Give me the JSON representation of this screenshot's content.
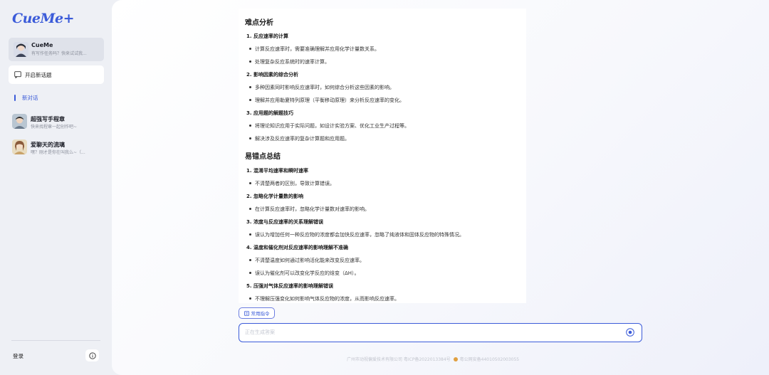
{
  "sidebar": {
    "logo": "CueMe+",
    "cueme_card": {
      "title": "CueMe",
      "subtitle": "有写作任务吗？快来试试我..."
    },
    "new_topic_label": "开启新话题",
    "new_chat_label": "新对话",
    "conversations": [
      {
        "title": "超强写手程章",
        "subtitle": "快来找程章一起创作吧~"
      },
      {
        "title": "爱聊天的流璃",
        "subtitle": "嘿？刚才是你在叫我么~（..."
      }
    ],
    "login_label": "登录"
  },
  "content": {
    "sections": [
      {
        "title": "难点分析",
        "items": [
          {
            "title": "1. 反应速率的计算",
            "bullets": [
              "计算反应速率时，需要准确理解并应用化学计量数关系。",
              "处理复杂反应系统时的速率计算。"
            ]
          },
          {
            "title": "2. 影响因素的综合分析",
            "bullets": [
              "多种因素同时影响反应速率时，如何综合分析这些因素的影响。",
              "理解并应用勒夏特列原理（平衡移动原理）来分析反应速率的变化。"
            ]
          },
          {
            "title": "3. 应用题的解题技巧",
            "bullets": [
              "将理论知识应用于实际问题，如设计实验方案、优化工业生产过程等。",
              "解决涉及反应速率的复杂计算题和应用题。"
            ]
          }
        ]
      },
      {
        "title": "易错点总结",
        "items": [
          {
            "title": "1. 混淆平均速率和瞬时速率",
            "bullets": [
              "不清楚两者的区别，导致计算错误。"
            ]
          },
          {
            "title": "2. 忽略化学计量数的影响",
            "bullets": [
              "在计算反应速率时，忽略化学计量数对速率的影响。"
            ]
          },
          {
            "title": "3. 浓度与反应速率的关系理解错误",
            "bullets": [
              "误认为增加任何一种反应物的浓度都会加快反应速率，忽略了纯液体和固体反应物的特殊情况。"
            ]
          },
          {
            "title": "4. 温度和催化剂对反应速率的影响理解不准确",
            "bullets": [
              "不清楚温度如何通过影响活化能来改变反应速率。",
              "误认为催化剂可以改变化学反应的焓变（ΔH）。"
            ]
          },
          {
            "title": "5. 压强对气体反应速率的影响理解错误",
            "bullets": [
              "不理解压强变化如何影响气体反应物的浓度，从而影响反应速率。"
            ]
          }
        ]
      }
    ]
  },
  "composer": {
    "command_label": "常用指令",
    "placeholder": "正在生成答案"
  },
  "footer": {
    "icp": "广州市动视偏爱技术有限公司 粤ICP备2022013384号",
    "police": "粤公网安备44010502003055"
  },
  "colors": {
    "accent": "#3b5bd9",
    "background": "#eef0f5"
  }
}
